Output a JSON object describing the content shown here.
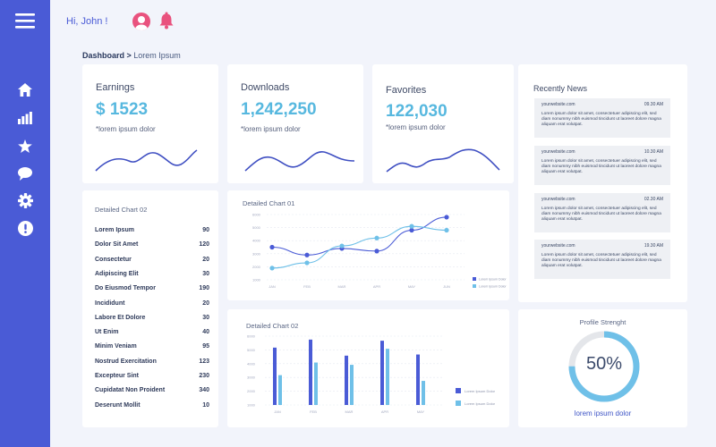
{
  "header": {
    "greeting": "Hi, John !"
  },
  "breadcrumb": {
    "current": "Dashboard >",
    "page": "Lorem Ipsum"
  },
  "stats": [
    {
      "title": "Earnings",
      "value": "$ 1523",
      "sub": "*lorem ipsum dolor"
    },
    {
      "title": "Downloads",
      "value": "1,242,250",
      "sub": "*lorem ipsum dolor"
    },
    {
      "title": "Favorites",
      "value": "122,030",
      "sub": "*lorem ipsum dolor"
    }
  ],
  "detailed_list": {
    "title": "Detailed Chart 02",
    "rows": [
      {
        "label": "Lorem Ipsum",
        "value": "90"
      },
      {
        "label": "Dolor Sit Amet",
        "value": "120"
      },
      {
        "label": "Consectetur",
        "value": "20"
      },
      {
        "label": "Adipiscing Elit",
        "value": "30"
      },
      {
        "label": "Do Eiusmod Tempor",
        "value": "190"
      },
      {
        "label": "Incididunt",
        "value": "20"
      },
      {
        "label": "Labore Et Dolore",
        "value": "30"
      },
      {
        "label": "Ut Enim",
        "value": "40"
      },
      {
        "label": "Minim Veniam",
        "value": "95"
      },
      {
        "label": "Nostrud Exercitation",
        "value": "123"
      },
      {
        "label": "Excepteur Sint",
        "value": "230"
      },
      {
        "label": "Cupidatat Non Proident",
        "value": "340"
      },
      {
        "label": "Deserunt Mollit",
        "value": "10"
      }
    ]
  },
  "news": {
    "title": "Recently News",
    "items": [
      {
        "site": "yourwebsite.com",
        "time": "09.30 AM",
        "text": "Lorem ipsum dolor sit amet, consectetuer adipiscing elit, sed diam nonummy nibh euismod tincidunt ut laoreet dolore magna aliquam erat volutpat."
      },
      {
        "site": "yourwebsite.com",
        "time": "10.30 AM",
        "text": "Lorem ipsum dolor sit amet, consectetuer adipiscing elit, sed diam nonummy nibh euismod tincidunt ut laoreet dolore magna aliquam erat volutpat."
      },
      {
        "site": "yourwebsite.com",
        "time": "02.30 AM",
        "text": "Lorem ipsum dolor sit amet, consectetuer adipiscing elit, sed diam nonummy nibh euismod tincidunt ut laoreet dolore magna aliquam erat volutpat."
      },
      {
        "site": "yourwebsite.com",
        "time": "19.30 AM",
        "text": "Lorem ipsum dolor sit amet, consectetuer adipiscing elit, sed diam nonummy nibh euismod tincidunt ut laoreet dolore magna aliquam erat volutpat."
      }
    ]
  },
  "profile": {
    "title": "Profile Strenght",
    "percent_label": "50%",
    "value": 0.75,
    "caption": "lorem ipsum dolor"
  },
  "colors": {
    "sidebar": "#4a5bd6",
    "accent": "#57b8df",
    "dark_series": "#4a5bd6",
    "light_series": "#6fc0e8"
  },
  "icons": [
    "menu-icon",
    "home-icon",
    "bar-chart-icon",
    "star-icon",
    "chat-icon",
    "gear-icon",
    "alert-icon",
    "bell-icon",
    "avatar"
  ],
  "chart_data": [
    {
      "type": "line",
      "title": "Detailed Chart 01",
      "categories": [
        "JAN",
        "FEB",
        "MAR",
        "APR",
        "MAY",
        "JUN"
      ],
      "yticks": [
        "6000",
        "5000",
        "4000",
        "3000",
        "2000",
        "1000"
      ],
      "ylim": [
        1000,
        6000
      ],
      "series": [
        {
          "name": "Lorem Ipsum Dolor",
          "color": "#4a5bd6",
          "values": [
            3500,
            2900,
            3400,
            3200,
            4800,
            5800
          ]
        },
        {
          "name": "Lorem Ipsum Dolor",
          "color": "#6fc0e8",
          "values": [
            1900,
            2300,
            3600,
            4200,
            5100,
            4800
          ]
        }
      ],
      "legend": "bottom-right"
    },
    {
      "type": "bar",
      "title": "Detailed Chart 02",
      "categories": [
        "JAN",
        "FEB",
        "MAR",
        "APR",
        "MAY"
      ],
      "yticks": [
        "6000",
        "5000",
        "4000",
        "3000",
        "2000",
        "1000"
      ],
      "ylim": [
        0,
        6000
      ],
      "series": [
        {
          "name": "Lorem Ipsum Dolor",
          "color": "#4a5bd6",
          "values": [
            5000,
            5700,
            4300,
            5600,
            4400
          ]
        },
        {
          "name": "Lorem Ipsum Dolor",
          "color": "#6fc0e8",
          "values": [
            2600,
            3700,
            3500,
            4900,
            2100
          ]
        }
      ],
      "legend": "bottom-right"
    }
  ]
}
